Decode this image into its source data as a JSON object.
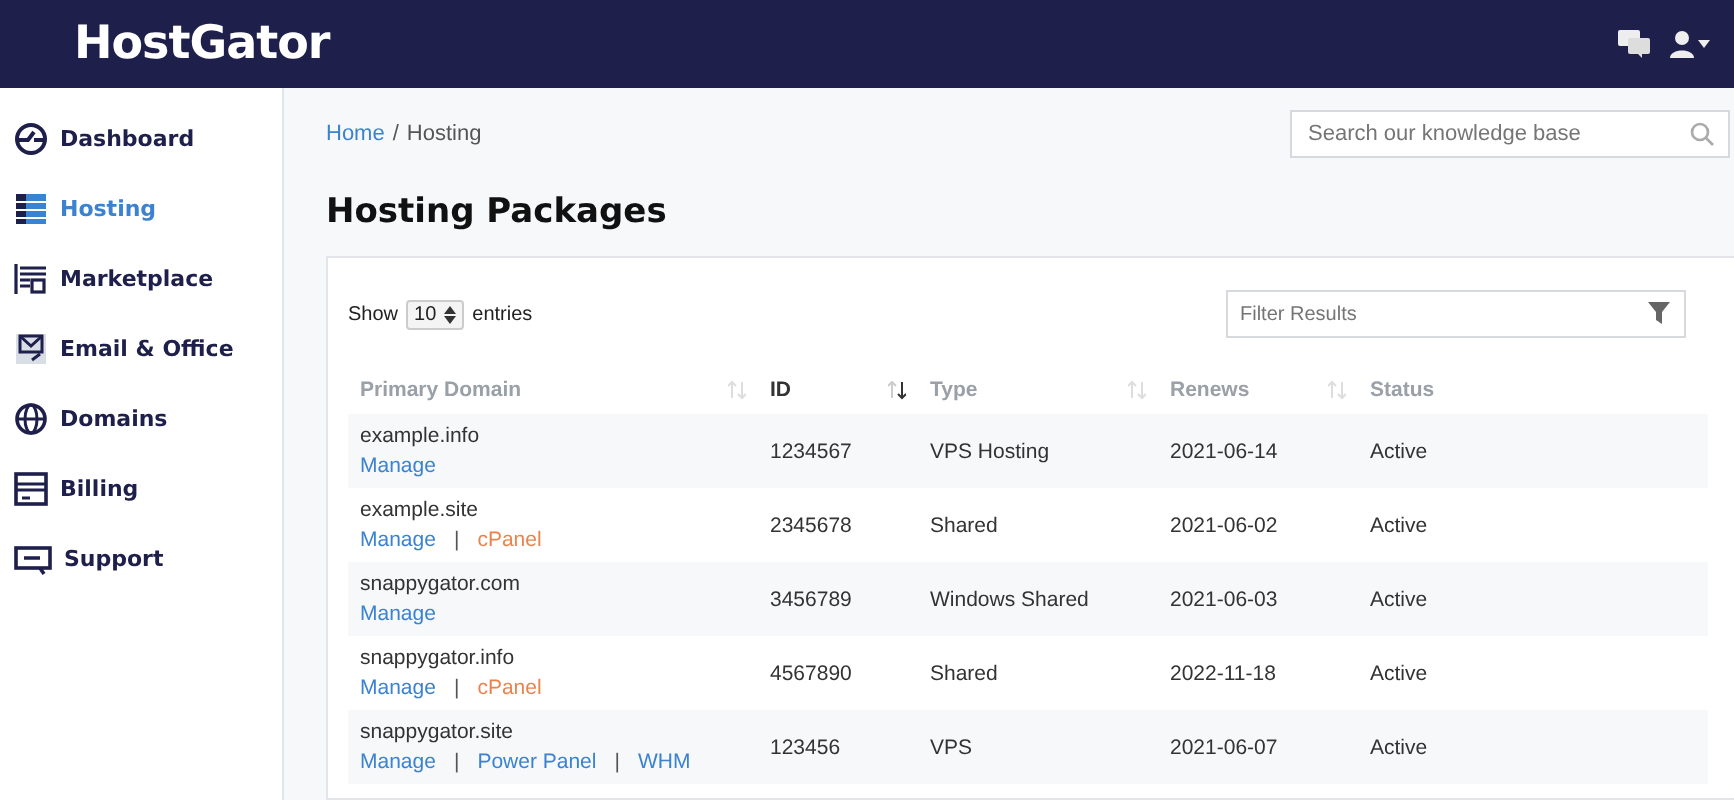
{
  "header": {
    "logo": "HostGator"
  },
  "sidebar": {
    "items": [
      {
        "label": "Dashboard",
        "selected": false
      },
      {
        "label": "Hosting",
        "selected": true
      },
      {
        "label": "Marketplace",
        "selected": false
      },
      {
        "label": "Email & Office",
        "selected": false
      },
      {
        "label": "Domains",
        "selected": false
      },
      {
        "label": "Billing",
        "selected": false
      },
      {
        "label": "Support",
        "selected": false
      }
    ]
  },
  "breadcrumb": {
    "separator": "/",
    "items": [
      {
        "label": "Home",
        "link": true
      },
      {
        "label": "Hosting",
        "link": false
      }
    ]
  },
  "search": {
    "placeholder": "Search our knowledge base"
  },
  "page_title": "Hosting Packages",
  "table_controls": {
    "show_label": "Show",
    "page_size": "10",
    "entries_label": "entries",
    "filter_placeholder": "Filter Results"
  },
  "table": {
    "link_separator": "|",
    "columns": [
      {
        "label": "Primary Domain",
        "sortable": true,
        "sorted": false
      },
      {
        "label": "ID",
        "sortable": true,
        "sorted": true
      },
      {
        "label": "Type",
        "sortable": true,
        "sorted": false
      },
      {
        "label": "Renews",
        "sortable": true,
        "sorted": false
      },
      {
        "label": "Status",
        "sortable": false,
        "sorted": false
      }
    ],
    "rows": [
      {
        "domain": "example.info",
        "links": [
          {
            "label": "Manage",
            "color": "#3b82d0"
          }
        ],
        "id": "1234567",
        "type": "VPS Hosting",
        "renews": "2021-06-14",
        "status": "Active"
      },
      {
        "domain": "example.site",
        "links": [
          {
            "label": "Manage",
            "color": "#3b82d0"
          },
          {
            "label": "cPanel",
            "color": "#e8844e"
          }
        ],
        "id": "2345678",
        "type": "Shared",
        "renews": "2021-06-02",
        "status": "Active"
      },
      {
        "domain": "snappygator.com",
        "links": [
          {
            "label": "Manage",
            "color": "#3b82d0"
          }
        ],
        "id": "3456789",
        "type": "Windows Shared",
        "renews": "2021-06-03",
        "status": "Active"
      },
      {
        "domain": "snappygator.info",
        "links": [
          {
            "label": "Manage",
            "color": "#3b82d0"
          },
          {
            "label": "cPanel",
            "color": "#e8844e"
          }
        ],
        "id": "4567890",
        "type": "Shared",
        "renews": "2022-11-18",
        "status": "Active"
      },
      {
        "domain": "snappygator.site",
        "links": [
          {
            "label": "Manage",
            "color": "#3b82d0"
          },
          {
            "label": "Power Panel",
            "color": "#3b82d0"
          },
          {
            "label": "WHM",
            "color": "#3b82d0"
          }
        ],
        "id": "123456",
        "type": "VPS",
        "renews": "2021-06-07",
        "status": "Active"
      }
    ]
  }
}
